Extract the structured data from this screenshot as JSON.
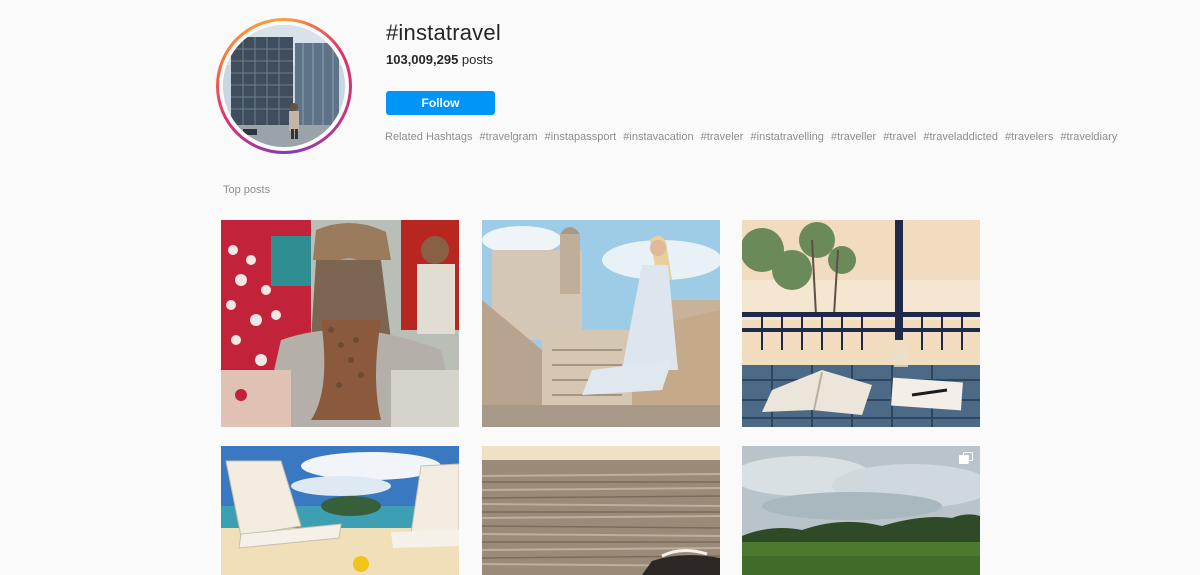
{
  "header": {
    "hashtag": "#instatravel",
    "post_count": "103,009,295",
    "post_count_label": "posts",
    "follow_label": "Follow"
  },
  "related": {
    "label": "Related Hashtags",
    "tags": [
      "#travelgram",
      "#instapassport",
      "#instavacation",
      "#traveler",
      "#instatravelling",
      "#traveller",
      "#travel",
      "#traveladdicted",
      "#travelers",
      "#traveldiary"
    ]
  },
  "top_posts": {
    "title": "Top posts"
  },
  "colors": {
    "follow_button": "#0095f6",
    "muted_text": "#8e8e8e",
    "background": "#fafafa"
  },
  "icons": {
    "multi_image": "carousel-icon"
  }
}
